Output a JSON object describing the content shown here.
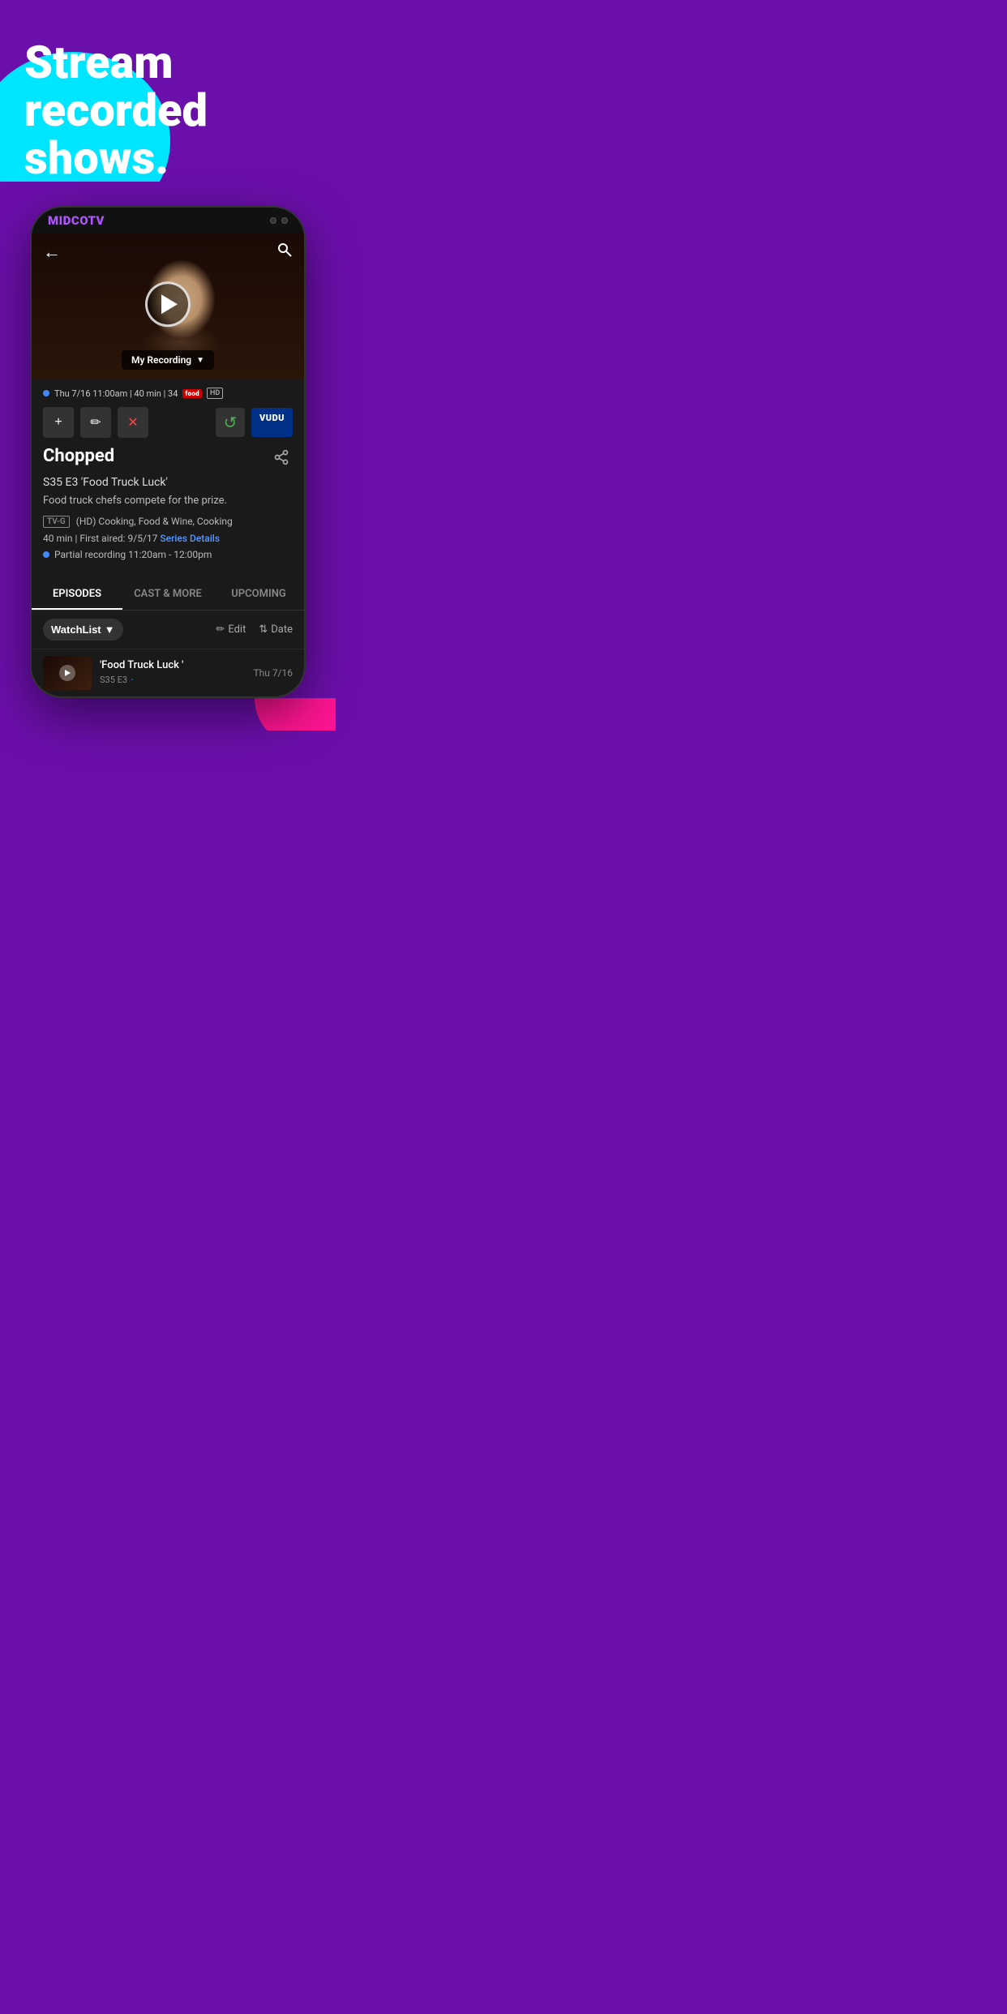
{
  "hero": {
    "title": "Stream recorded shows."
  },
  "phone": {
    "logo_text": "MIDCO",
    "logo_accent": "TV"
  },
  "video": {
    "recording_label": "My Recording",
    "back_icon": "←",
    "search_icon": "🔍"
  },
  "meta": {
    "airtime": "Thu 7/16 11:00am | 40 min | 34",
    "hd": "HD"
  },
  "show": {
    "title": "Chopped",
    "episode": "S35 E3 'Food Truck Luck'",
    "description": "Food truck chefs compete for the prize.",
    "rating": "TV-G",
    "rating_suffix": "(HD) Cooking, Food & Wine, Cooking",
    "duration": "40 min | First aired: 9/5/17",
    "series_details": "Series Details",
    "partial": "Partial recording 11:20am - 12:00pm"
  },
  "tabs": [
    {
      "label": "EPISODES",
      "active": true
    },
    {
      "label": "CAST & MORE",
      "active": false
    },
    {
      "label": "UPCOMING",
      "active": false
    }
  ],
  "list_header": {
    "watchlist": "WatchList",
    "edit": "Edit",
    "date": "Date"
  },
  "episode": {
    "title": "'Food Truck Luck '",
    "meta": "S35 E3",
    "date": "Thu 7/16"
  },
  "buttons": {
    "add": "+",
    "edit_pencil": "✏",
    "delete": "✕",
    "replay": "↺",
    "vudu": "VUDU",
    "share": "⬆"
  }
}
